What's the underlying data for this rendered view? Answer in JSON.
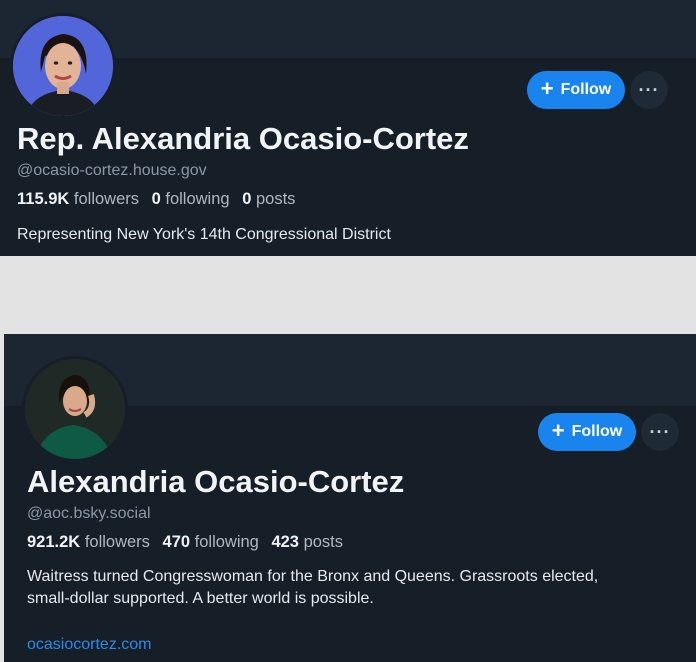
{
  "profiles": [
    {
      "display_name": "Rep. Alexandria Ocasio-Cortez",
      "handle": "@ocasio-cortez.house.gov",
      "followers_count": "115.9K",
      "followers_label": "followers",
      "following_count": "0",
      "following_label": "following",
      "posts_count": "0",
      "posts_label": "posts",
      "bio": "Representing New York's 14th Congressional District",
      "follow_label": "Follow",
      "more_label": "···"
    },
    {
      "display_name": "Alexandria Ocasio-Cortez",
      "handle": "@aoc.bsky.social",
      "followers_count": "921.2K",
      "followers_label": "followers",
      "following_count": "470",
      "following_label": "following",
      "posts_count": "423",
      "posts_label": "posts",
      "bio_line1": "Waitress turned Congresswoman for the Bronx and Queens. Grassroots elected,",
      "bio_line2": "small-dollar supported. A better world is possible.",
      "link": "ocasiocortez.com",
      "follow_label": "Follow",
      "more_label": "···"
    }
  ],
  "colors": {
    "card_bg": "#161e27",
    "banner_bg": "#1c2633",
    "follow_blue": "#1a84ee",
    "link_blue": "#2b8be8",
    "page_bg": "#e3e3e4"
  }
}
